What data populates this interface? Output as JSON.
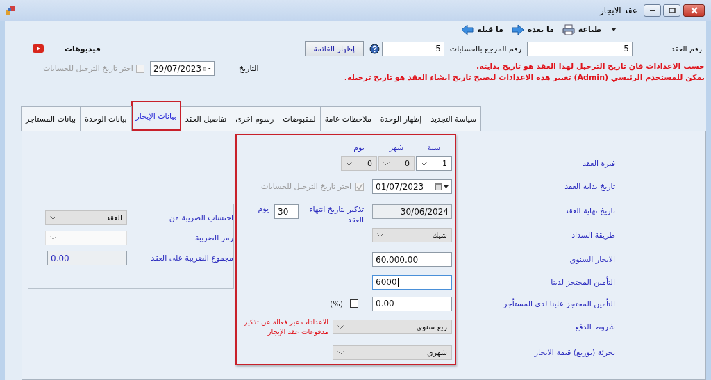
{
  "window": {
    "title": "عقد الايجار"
  },
  "toolbar": [
    {
      "kind": "print",
      "label": "طباعة"
    },
    {
      "kind": "next",
      "label": "ما بعده"
    },
    {
      "kind": "prev",
      "label": "ما قبله"
    }
  ],
  "header": {
    "contract_no": {
      "label": "رقم العقد",
      "value": "5"
    },
    "reference": {
      "label": "رقم المرجع بالحسابات",
      "value": "5"
    },
    "show_list_button": "إظهار القائمة",
    "videos": "فيديوهات",
    "notices": [
      "حسب الاعدادات فان تاريخ الترحيل لهذا العقد هو تاريخ بدايته.",
      "يمكن للمستخدم الرئيسي (Admin) تغيير هذه الاعدادات ليصبح تاريخ انشاء العقد هو تاريخ ترحيله."
    ],
    "date": {
      "label": "التاريخ",
      "value": "29/07/2023"
    },
    "posting_checkbox": {
      "label": "اختر تاريخ الترحيل للحسابات",
      "checked": false,
      "disabled": true
    }
  },
  "tabs": [
    {
      "label": "سياسة التجديد",
      "selected": false
    },
    {
      "label": "إظهار الوحدة",
      "selected": false
    },
    {
      "label": "ملاحظات عامة",
      "selected": false
    },
    {
      "label": "لمقبوضات",
      "selected": false
    },
    {
      "label": "رسوم اخرى",
      "selected": false
    },
    {
      "label": "تفاصيل العقد",
      "selected": false
    },
    {
      "label": "بيانات الإيجار",
      "selected": true
    },
    {
      "label": "بيانات الوحدة",
      "selected": false
    },
    {
      "label": "بيانات المستاجر",
      "selected": false
    }
  ],
  "period": {
    "label": "فترة العقد",
    "units": [
      {
        "label": "سنة",
        "value": "1",
        "disabled": false
      },
      {
        "label": "شهر",
        "value": "0",
        "disabled": true
      },
      {
        "label": "يوم",
        "value": "0",
        "disabled": true
      }
    ]
  },
  "start_date": {
    "label": "تاريخ بداية العقد",
    "value": "01/07/2023",
    "posting_checkbox": {
      "label": "اختر تاريخ الترحيل للحسابات",
      "checked": true,
      "disabled": true
    }
  },
  "end_date": {
    "label": "تاريخ نهاية العقد",
    "value": "30/06/2024",
    "reminder": {
      "label": "تذكير بتاريخ انتهاء العقد",
      "value": "30",
      "unit": "يوم"
    }
  },
  "payment_method": {
    "label": "طريقة السداد",
    "value": "شيك",
    "disabled": true
  },
  "annual_rent": {
    "label": "الايجار السنوي",
    "value": "60,000.00",
    "focused": false
  },
  "deposit_held": {
    "label": "التأمين المحتجز لدينا",
    "value": "6000",
    "focused": true
  },
  "deposit_paid": {
    "label": "التأمين المحتجز علينا لدى المستأجر",
    "value": "0.00",
    "focused": false,
    "percent": {
      "label": "(%)",
      "checked": false
    }
  },
  "payment_terms": {
    "label": "شروط الدفع",
    "value": "ربع سنوي",
    "disabled": true,
    "note": "الاعدادات غير فعالة عن تذكير مدفوعات عقد الإيجار"
  },
  "rent_split": {
    "label": "تجزئة (توزيع) قيمة الايجار",
    "value": "شهري",
    "disabled": true
  },
  "tax": {
    "basis": {
      "label": "احتساب الضريبة من",
      "value": "العقد",
      "disabled": true
    },
    "code": {
      "label": "رمز الضريبة",
      "disabled": true
    },
    "total": {
      "label": "مجموع الضريبة على العقد",
      "value": "0.00"
    }
  }
}
